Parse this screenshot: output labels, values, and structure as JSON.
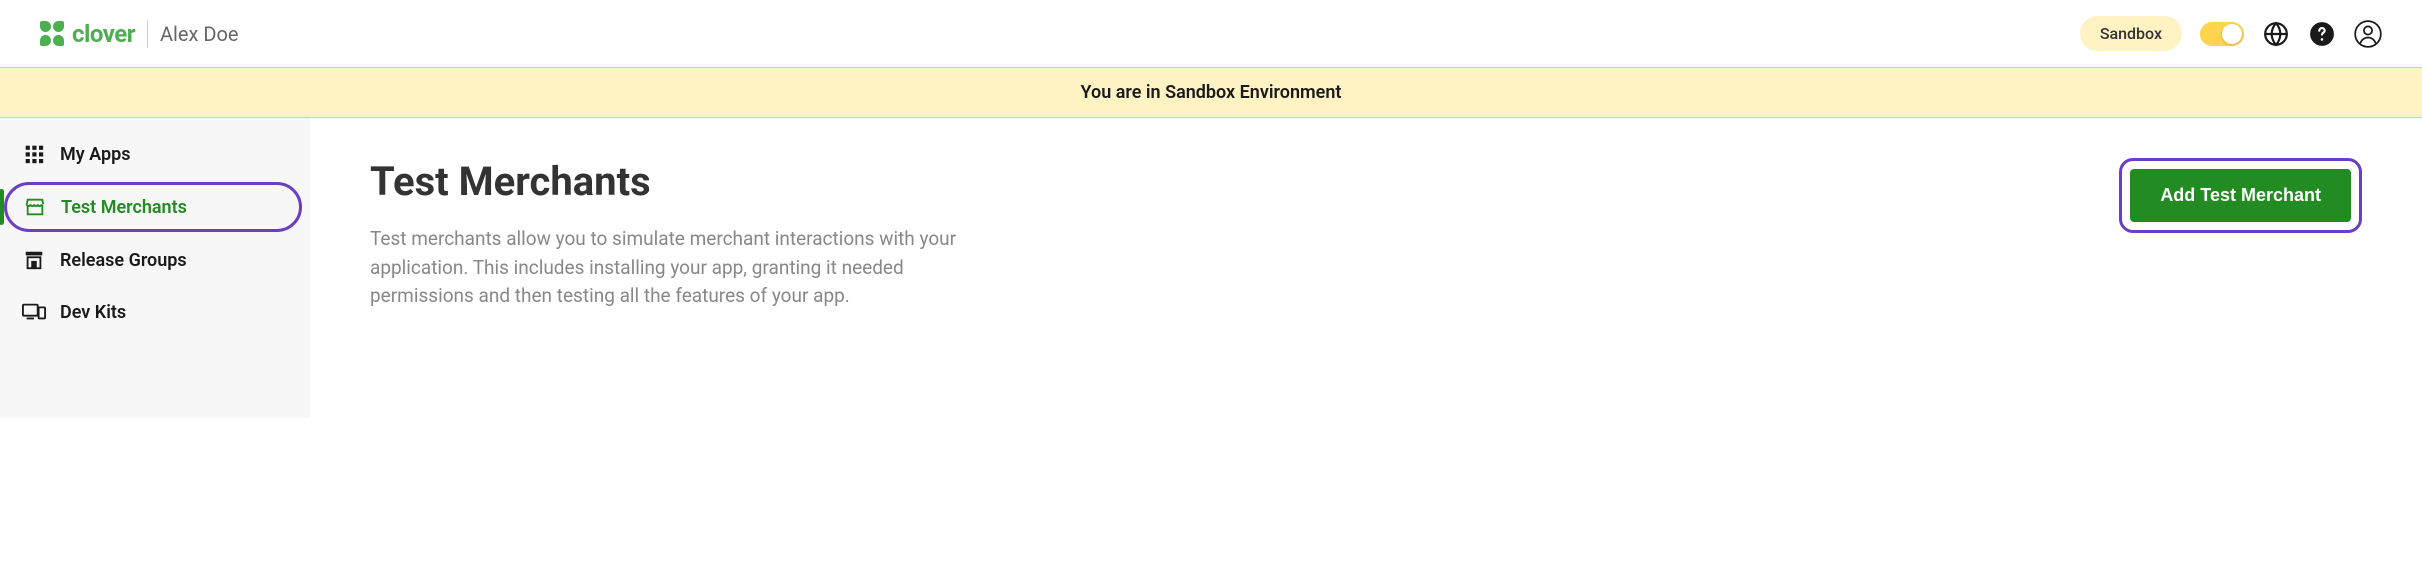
{
  "header": {
    "logo_text": "clover",
    "username": "Alex Doe",
    "sandbox_badge": "Sandbox"
  },
  "banner": {
    "text": "You are in Sandbox Environment"
  },
  "sidebar": {
    "items": [
      {
        "label": "My Apps",
        "icon": "grid-icon",
        "active": false
      },
      {
        "label": "Test Merchants",
        "icon": "storefront-icon",
        "active": true
      },
      {
        "label": "Release Groups",
        "icon": "store-icon",
        "active": false
      },
      {
        "label": "Dev Kits",
        "icon": "devices-icon",
        "active": false
      }
    ]
  },
  "content": {
    "title": "Test Merchants",
    "description": "Test merchants allow you to simulate merchant interactions with your application. This includes installing your app, granting it needed permissions and then testing all the features of your app.",
    "add_button": "Add Test Merchant"
  },
  "colors": {
    "brand_green": "#4CAF50",
    "action_green": "#228B22",
    "highlight_purple": "#6B3FBF",
    "sandbox_yellow": "#FFF3C4"
  }
}
